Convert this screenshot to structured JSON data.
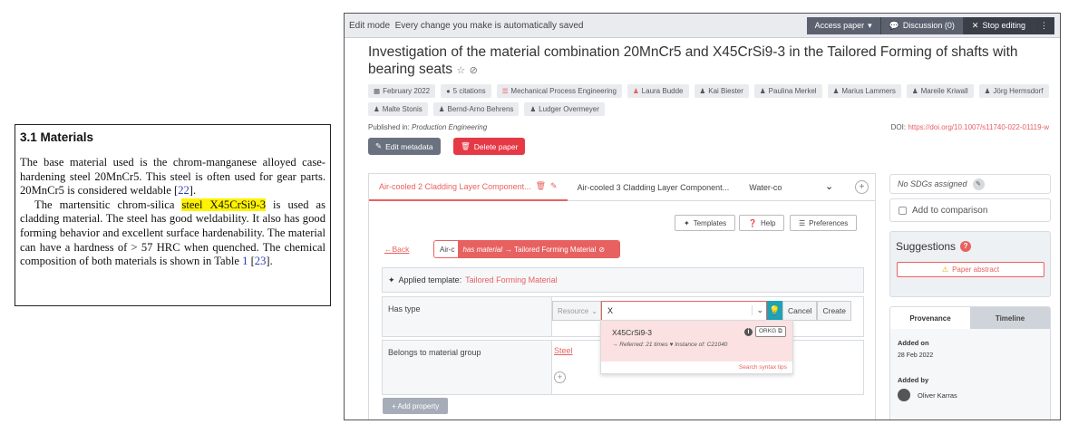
{
  "paper_excerpt": {
    "heading": "3.1  Materials",
    "p1_text": "The base material used is the chrom-manganese alloyed case-hardening steel 20MnCr5. This steel is often used for gear parts. 20MnCr5 is considered weldable [",
    "p1_ref": "22",
    "p1_end": "].",
    "p2_start": "The martensitic chrom-silica ",
    "p2_highlight": "steel X45CrSi9-3",
    "p2_mid": " is used as cladding material. The steel has good weldability. It also has good forming behavior and excellent surface hardenability. The material can have a hardness of > 57 HRC when quenched. The chemical composition of both materials is shown in Table ",
    "p2_ref1": "1",
    "p2_sep": " [",
    "p2_ref2": "23",
    "p2_end": "]."
  },
  "editbar": {
    "mode": "Edit mode",
    "message": "Every change you make is automatically saved",
    "access_label": "Access paper",
    "discussion_label": "Discussion (0)",
    "stop_label": "Stop editing"
  },
  "paper": {
    "title": "Investigation of the material combination 20MnCr5 and X45CrSi9-3 in the Tailored Forming of shafts with bearing seats",
    "date": "February 2022",
    "citations": "5 citations",
    "field": "Mechanical Process Engineering",
    "authors": [
      "Laura Budde",
      "Kai Biester",
      "Paulina Merkel",
      "Marius Lammers",
      "Mareile Kriwall",
      "Jörg Hermsdorf",
      "Malte Stonis",
      "Bernd-Arno Behrens",
      "Ludger Overmeyer"
    ],
    "published_prefix": "Published in: ",
    "venue": "Production Engineering",
    "doi_prefix": "DOI: ",
    "doi": "https://doi.org/10.1007/s11740-022-01119-w",
    "edit_metadata": "Edit metadata",
    "delete_paper": "Delete paper"
  },
  "contributions": {
    "tabs": [
      "Air-cooled 2 Cladding Layer Component...",
      "Air-cooled 3 Cladding Layer Component...",
      "Water-co"
    ],
    "toolbar": {
      "templates": "Templates",
      "help": "Help",
      "preferences": "Preferences"
    },
    "back": "Back",
    "relation_start": "Air-c",
    "relation_predicate": "has material",
    "relation_object": "→ Tailored Forming Material",
    "applied_label": "Applied template:",
    "applied_template": "Tailored Forming Material",
    "has_type_label": "Has type",
    "resource_select": "Resource",
    "input_value": "X",
    "cancel": "Cancel",
    "create": "Create",
    "suggestion_name": "X45CrSi9-3",
    "suggestion_meta": "→ Referred: 21 times ♥ Instance of: C21040",
    "orkg": "ORKG",
    "search_tips": "Search syntax tips",
    "group_label": "Belongs to material group",
    "group_value": "Steel",
    "add_property": "+ Add property"
  },
  "sidebar": {
    "sdg": "No SDGs assigned",
    "add_compare": "Add to comparison",
    "suggestions_title": "Suggestions",
    "suggestions_count": "?",
    "paper_abstract": "Paper abstract",
    "prov_tab": "Provenance",
    "timeline_tab": "Timeline",
    "added_on_label": "Added on",
    "added_on": "28 Feb 2022",
    "added_by_label": "Added by",
    "added_by": "Oliver Karras"
  }
}
